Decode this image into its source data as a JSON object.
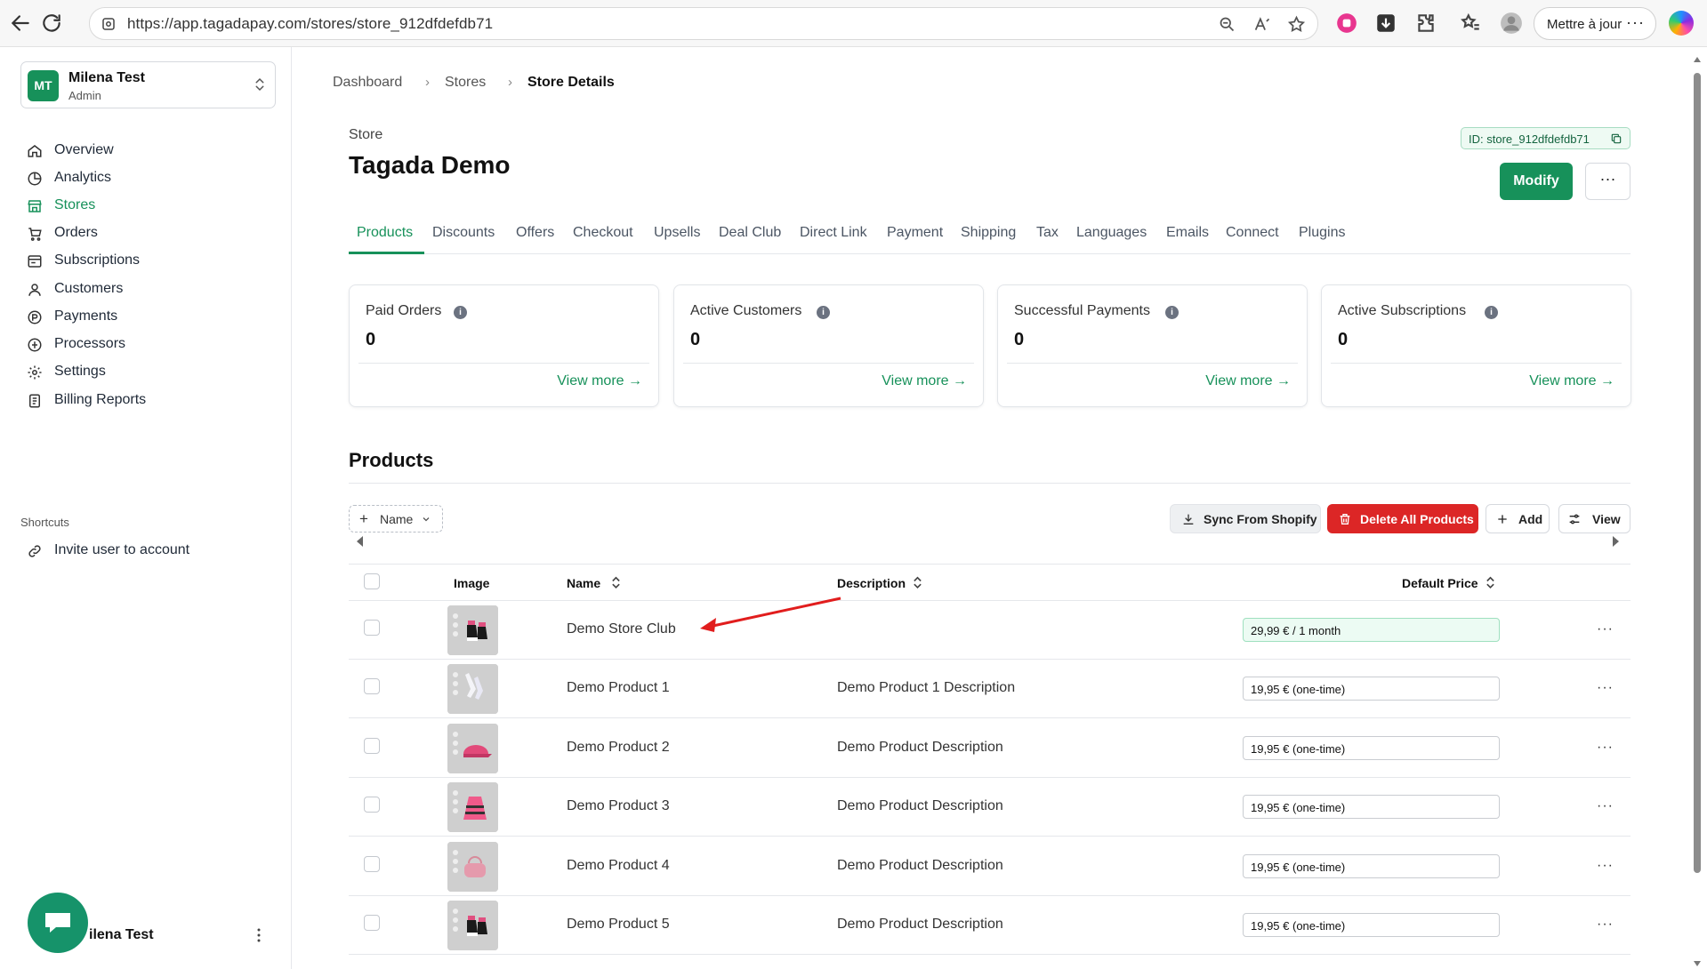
{
  "browser": {
    "url": "https://app.tagadapay.com/stores/store_912dfdefdb71",
    "update_label": "Mettre à jour"
  },
  "sidebar": {
    "account": {
      "initials": "MT",
      "name": "Milena Test",
      "role": "Admin"
    },
    "items": [
      {
        "label": "Overview",
        "icon": "home-icon"
      },
      {
        "label": "Analytics",
        "icon": "pie-chart-icon"
      },
      {
        "label": "Stores",
        "icon": "store-icon",
        "active": true
      },
      {
        "label": "Orders",
        "icon": "cart-icon"
      },
      {
        "label": "Subscriptions",
        "icon": "subscriptions-icon"
      },
      {
        "label": "Customers",
        "icon": "user-icon"
      },
      {
        "label": "Payments",
        "icon": "coin-icon"
      },
      {
        "label": "Processors",
        "icon": "processor-icon"
      },
      {
        "label": "Settings",
        "icon": "gear-icon"
      },
      {
        "label": "Billing Reports",
        "icon": "report-icon"
      }
    ],
    "shortcuts_heading": "Shortcuts",
    "shortcuts": [
      {
        "label": "Invite user to account",
        "icon": "link-icon"
      }
    ],
    "footer_user": "ilena Test"
  },
  "breadcrumb": [
    "Dashboard",
    "Stores",
    "Store Details"
  ],
  "store": {
    "label": "Store",
    "title": "Tagada Demo",
    "id": "ID: store_912dfdefdb71",
    "modify_label": "Modify",
    "more_label": "···"
  },
  "tabs": [
    "Products",
    "Discounts",
    "Offers",
    "Checkout",
    "Upsells",
    "Deal Club",
    "Direct Link",
    "Payment",
    "Shipping",
    "Tax",
    "Languages",
    "Emails",
    "Connect",
    "Plugins"
  ],
  "active_tab": "Products",
  "stats": [
    {
      "title": "Paid Orders",
      "value": "0",
      "link": "View more →"
    },
    {
      "title": "Active Customers",
      "value": "0",
      "link": "View more →"
    },
    {
      "title": "Successful Payments",
      "value": "0",
      "link": "View more →"
    },
    {
      "title": "Active Subscriptions",
      "value": "0",
      "link": "View more →"
    }
  ],
  "products": {
    "heading": "Products",
    "filter_label": "Name",
    "toolbar": {
      "sync": "Sync From Shopify",
      "delete_all": "Delete All Products",
      "add": "Add",
      "view": "View"
    },
    "columns": {
      "image": "Image",
      "name": "Name",
      "description": "Description",
      "price": "Default Price"
    },
    "rows": [
      {
        "name": "Demo Store Club",
        "description": "",
        "price": "29,99 € / 1 month",
        "thumb": "gloves",
        "recurring": true
      },
      {
        "name": "Demo Product 1",
        "description": "Demo Product 1 Description",
        "price": "19,95 € (one-time)",
        "thumb": "socks"
      },
      {
        "name": "Demo Product 2",
        "description": "Demo Product Description",
        "price": "19,95 € (one-time)",
        "thumb": "cap"
      },
      {
        "name": "Demo Product 3",
        "description": "Demo Product Description",
        "price": "19,95 € (one-time)",
        "thumb": "skirt"
      },
      {
        "name": "Demo Product 4",
        "description": "Demo Product Description",
        "price": "19,95 € (one-time)",
        "thumb": "bag"
      },
      {
        "name": "Demo Product 5",
        "description": "Demo Product Description",
        "price": "19,95 € (one-time)",
        "thumb": "gloves"
      }
    ]
  },
  "colors": {
    "brand": "#17915a",
    "danger": "#dc2626",
    "annotation_arrow": "#e11d1d"
  }
}
